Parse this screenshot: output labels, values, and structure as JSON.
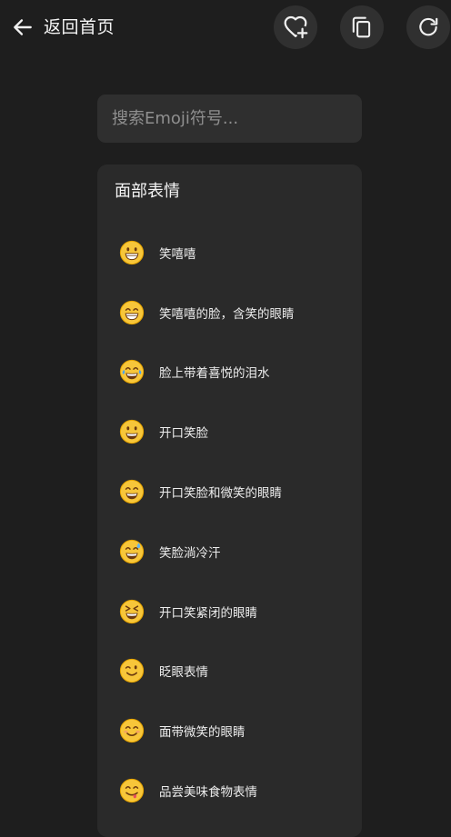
{
  "header": {
    "back_label": "返回首页"
  },
  "search": {
    "placeholder": "搜索Emoji符号..."
  },
  "category": {
    "title": "面部表情",
    "items": [
      {
        "name": "笑嘻嘻",
        "variant": "grin"
      },
      {
        "name": "笑嘻嘻的脸，含笑的眼睛",
        "variant": "beam"
      },
      {
        "name": "脸上带着喜悦的泪水",
        "variant": "tears"
      },
      {
        "name": "开口笑脸",
        "variant": "smiley"
      },
      {
        "name": "开口笑脸和微笑的眼睛",
        "variant": "smile"
      },
      {
        "name": "笑脸淌冷汗",
        "variant": "sweat"
      },
      {
        "name": "开口笑紧闭的眼睛",
        "variant": "squint"
      },
      {
        "name": "眨眼表情",
        "variant": "wink"
      },
      {
        "name": "面带微笑的眼睛",
        "variant": "blush"
      },
      {
        "name": "品尝美味食物表情",
        "variant": "yum"
      }
    ]
  },
  "colors": {
    "background": "#1e1e1e",
    "button": "#303030",
    "panel": "#2a2a2a",
    "search": "#2f2f2f",
    "emoji_face": "#f7c63a",
    "emoji_outline": "#e6a400"
  }
}
